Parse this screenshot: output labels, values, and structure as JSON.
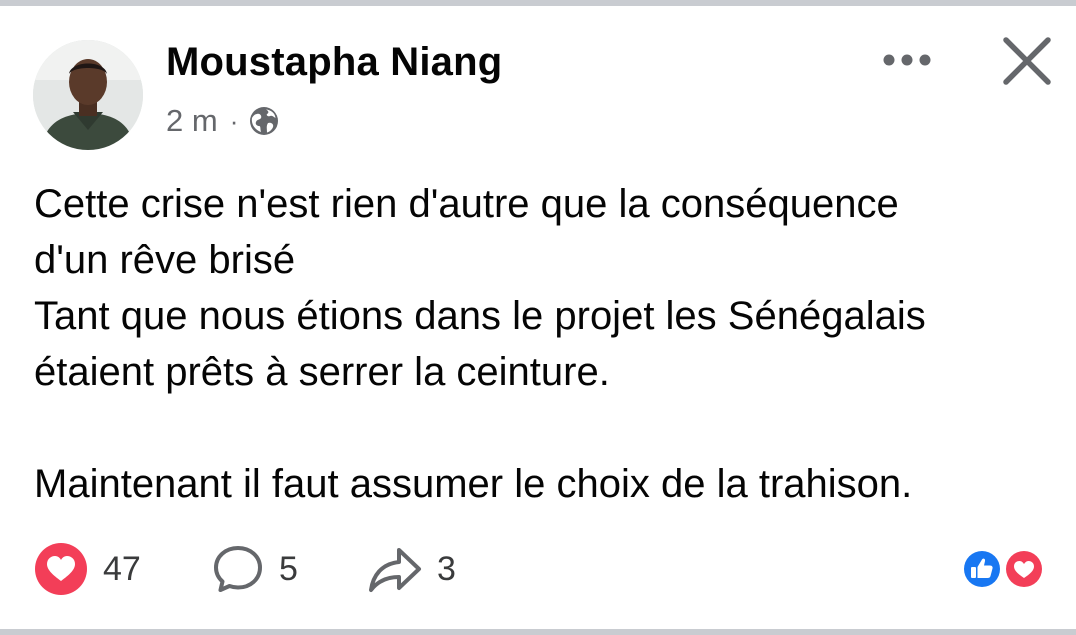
{
  "post": {
    "author": "Moustapha Niang",
    "time": "2 m",
    "separator": "·",
    "privacy_icon": "globe-icon",
    "lines": [
      "Cette crise n'est rien d'autre que la conséquence",
      "d'un rêve brisé",
      "Tant que nous étions dans le projet les Sénégalais",
      "étaient prêts à serrer la ceinture.",
      "",
      "Maintenant il faut assumer le choix de la trahison."
    ]
  },
  "actions": {
    "love_count": "47",
    "comment_count": "5",
    "share_count": "3"
  },
  "colors": {
    "love": "#f33e58",
    "like": "#1877f2",
    "text": "#050505",
    "secondary": "#65676b"
  }
}
